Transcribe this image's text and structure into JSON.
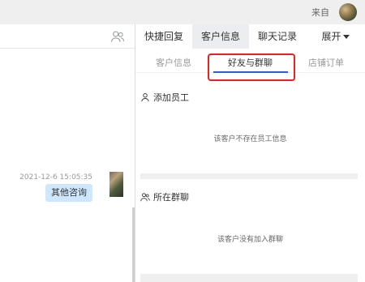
{
  "topbar": {
    "from_label": "来自"
  },
  "chat": {
    "message_time": "2021-12-6 15:05:35",
    "message_text": "其他咨询"
  },
  "right": {
    "main_tabs": [
      "快捷回复",
      "客户信息",
      "聊天记录",
      "展开"
    ],
    "sub_tabs": [
      "客户信息",
      "好友与群聊",
      "店铺订单"
    ],
    "section1": {
      "title": "添加员工",
      "empty": "该客户不存在员工信息"
    },
    "section2": {
      "title": "所在群聊",
      "empty": "该客户没有加入群聊"
    }
  },
  "colors": {
    "accent": "#2f5bd3",
    "highlight": "#e62222",
    "bubble": "#cfe6ff",
    "active_tab_bg": "#ebedf0"
  },
  "icons": {
    "contacts": "contacts-icon",
    "user": "user-icon",
    "group": "group-icon",
    "caret": "caret-down-icon"
  }
}
